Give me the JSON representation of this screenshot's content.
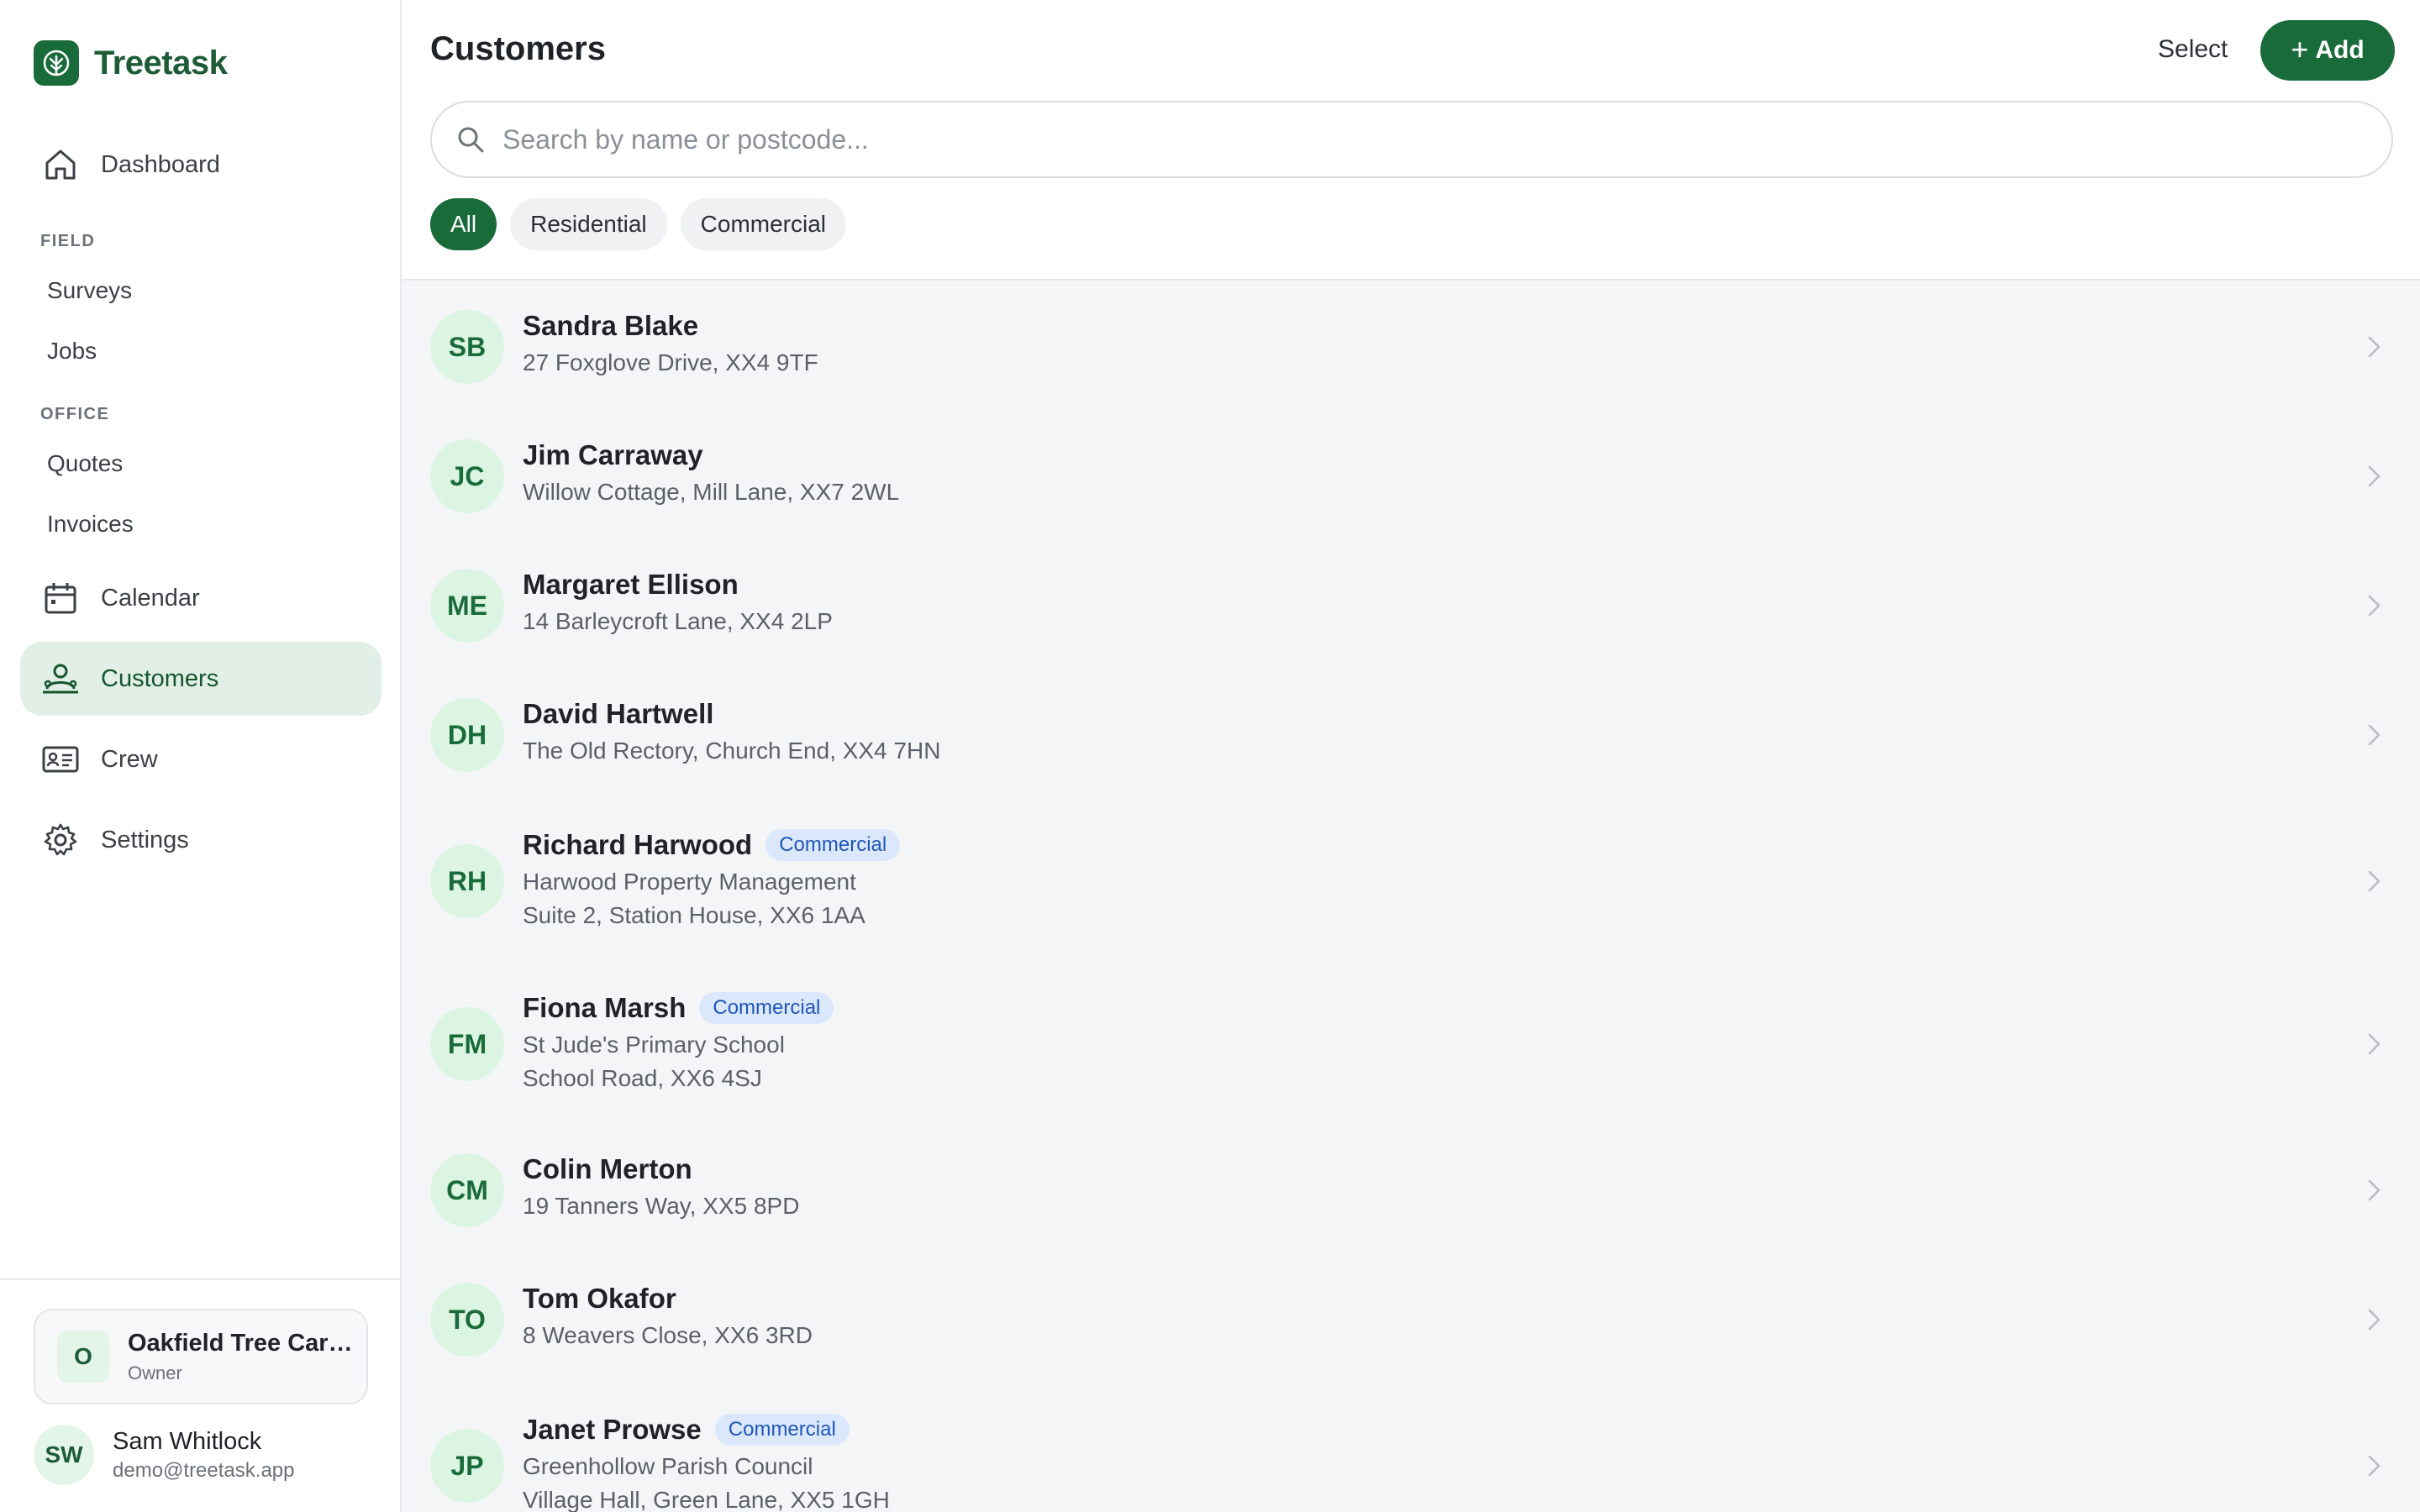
{
  "brand": {
    "name": "Treetask"
  },
  "nav": {
    "dashboard": "Dashboard",
    "section_field": "FIELD",
    "surveys": "Surveys",
    "jobs": "Jobs",
    "section_office": "OFFICE",
    "quotes": "Quotes",
    "invoices": "Invoices",
    "calendar": "Calendar",
    "customers": "Customers",
    "crew": "Crew",
    "settings": "Settings"
  },
  "org": {
    "initial": "O",
    "name": "Oakfield Tree Care Ltd",
    "role": "Owner"
  },
  "user": {
    "initials": "SW",
    "name": "Sam Whitlock",
    "email": "demo@treetask.app"
  },
  "header": {
    "title": "Customers",
    "select_label": "Select",
    "add_label": "Add"
  },
  "search": {
    "placeholder": "Search by name or postcode...",
    "value": ""
  },
  "filters": [
    "All",
    "Residential",
    "Commercial"
  ],
  "active_filter": "All",
  "colors": {
    "accent": "#1a6b3a",
    "tag_bg": "#dbe8fb",
    "tag_text": "#1f56b8",
    "avatar_bg": "#dcf5e3"
  },
  "customers": [
    {
      "initials": "SB",
      "name": "Sandra Blake",
      "tag": "",
      "lines": [
        "27 Foxglove Drive, XX4 9TF"
      ]
    },
    {
      "initials": "JC",
      "name": "Jim Carraway",
      "tag": "",
      "lines": [
        "Willow Cottage, Mill Lane, XX7 2WL"
      ]
    },
    {
      "initials": "ME",
      "name": "Margaret Ellison",
      "tag": "",
      "lines": [
        "14 Barleycroft Lane, XX4 2LP"
      ]
    },
    {
      "initials": "DH",
      "name": "David Hartwell",
      "tag": "",
      "lines": [
        "The Old Rectory, Church End, XX4 7HN"
      ]
    },
    {
      "initials": "RH",
      "name": "Richard Harwood",
      "tag": "Commercial",
      "lines": [
        "Harwood Property Management",
        "Suite 2, Station House, XX6 1AA"
      ]
    },
    {
      "initials": "FM",
      "name": "Fiona Marsh",
      "tag": "Commercial",
      "lines": [
        "St Jude's Primary School",
        "School Road, XX6 4SJ"
      ]
    },
    {
      "initials": "CM",
      "name": "Colin Merton",
      "tag": "",
      "lines": [
        "19 Tanners Way, XX5 8PD"
      ]
    },
    {
      "initials": "TO",
      "name": "Tom Okafor",
      "tag": "",
      "lines": [
        "8 Weavers Close, XX6 3RD"
      ]
    },
    {
      "initials": "JP",
      "name": "Janet Prowse",
      "tag": "Commercial",
      "lines": [
        "Greenhollow Parish Council",
        "Village Hall, Green Lane, XX5 1GH"
      ]
    }
  ]
}
